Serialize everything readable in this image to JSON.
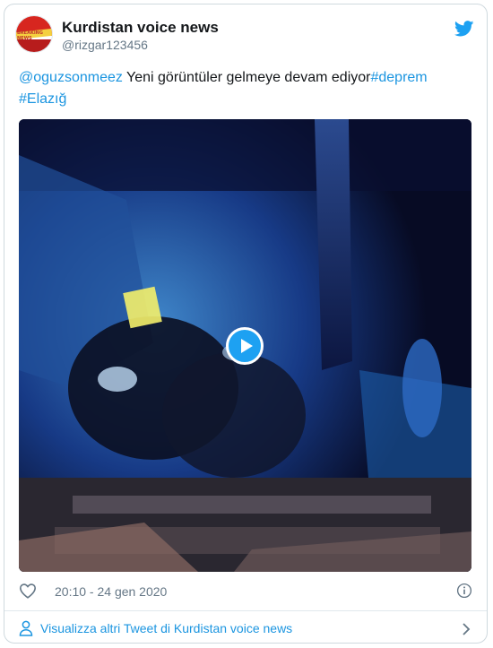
{
  "tweet": {
    "author_name": "Kurdistan voice news",
    "handle": "@rizgar123456",
    "avatar_text": "BREAKING NEWS",
    "text_mention": "@oguzsonmeez",
    "text_body": " Yeni görüntüler gelmeye devam ediyor",
    "hashtag_1": "#deprem",
    "hashtag_2": "#Elazığ",
    "timestamp": "20:10 - 24 gen 2020"
  },
  "footer": {
    "more_tweets_label": "Visualizza altri Tweet di Kurdistan voice news"
  },
  "icons": {
    "brand": "twitter-bird-icon",
    "play": "play-icon",
    "like": "heart-icon",
    "info": "info-icon",
    "profile": "person-icon",
    "chevron": "chevron-right-icon"
  },
  "colors": {
    "link": "#1b95e0",
    "twitter_blue": "#1da1f2",
    "meta_text": "#657786"
  }
}
